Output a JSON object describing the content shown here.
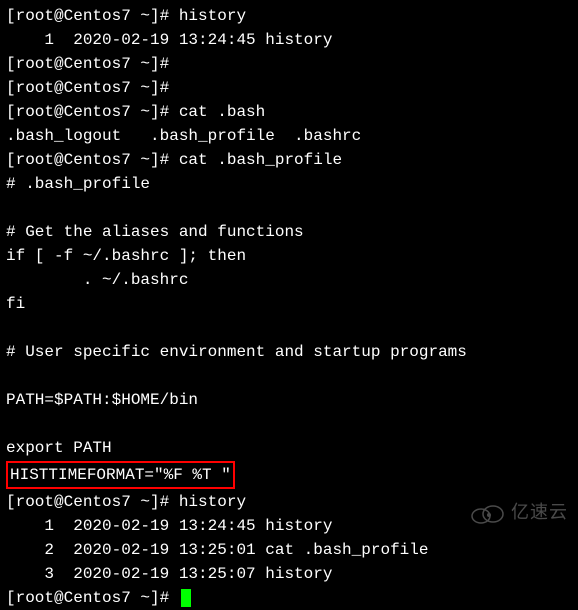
{
  "terminal": {
    "l01_prompt": "[root@Centos7 ~]# ",
    "l01_cmd": "history",
    "l02": "    1  2020-02-19 13:24:45 history",
    "l03_prompt": "[root@Centos7 ~]# ",
    "l04_prompt": "[root@Centos7 ~]# ",
    "l05_prompt": "[root@Centos7 ~]# ",
    "l05_cmd": "cat .bash",
    "l06": ".bash_logout   .bash_profile  .bashrc",
    "l07_prompt": "[root@Centos7 ~]# ",
    "l07_cmd": "cat .bash_profile",
    "l08": "# .bash_profile",
    "l09": "",
    "l10": "# Get the aliases and functions",
    "l11": "if [ -f ~/.bashrc ]; then",
    "l12": "        . ~/.bashrc",
    "l13": "fi",
    "l14": "",
    "l15": "# User specific environment and startup programs",
    "l16": "",
    "l17": "PATH=$PATH:$HOME/bin",
    "l18": "",
    "l19": "export PATH",
    "l20_highlight": "HISTTIMEFORMAT=\"%F %T \"",
    "l21_prompt": "[root@Centos7 ~]# ",
    "l21_cmd": "history",
    "l22": "    1  2020-02-19 13:24:45 history",
    "l23": "    2  2020-02-19 13:25:01 cat .bash_profile",
    "l24": "    3  2020-02-19 13:25:07 history",
    "l25_prompt": "[root@Centos7 ~]# "
  },
  "watermark": {
    "text": "亿速云"
  }
}
